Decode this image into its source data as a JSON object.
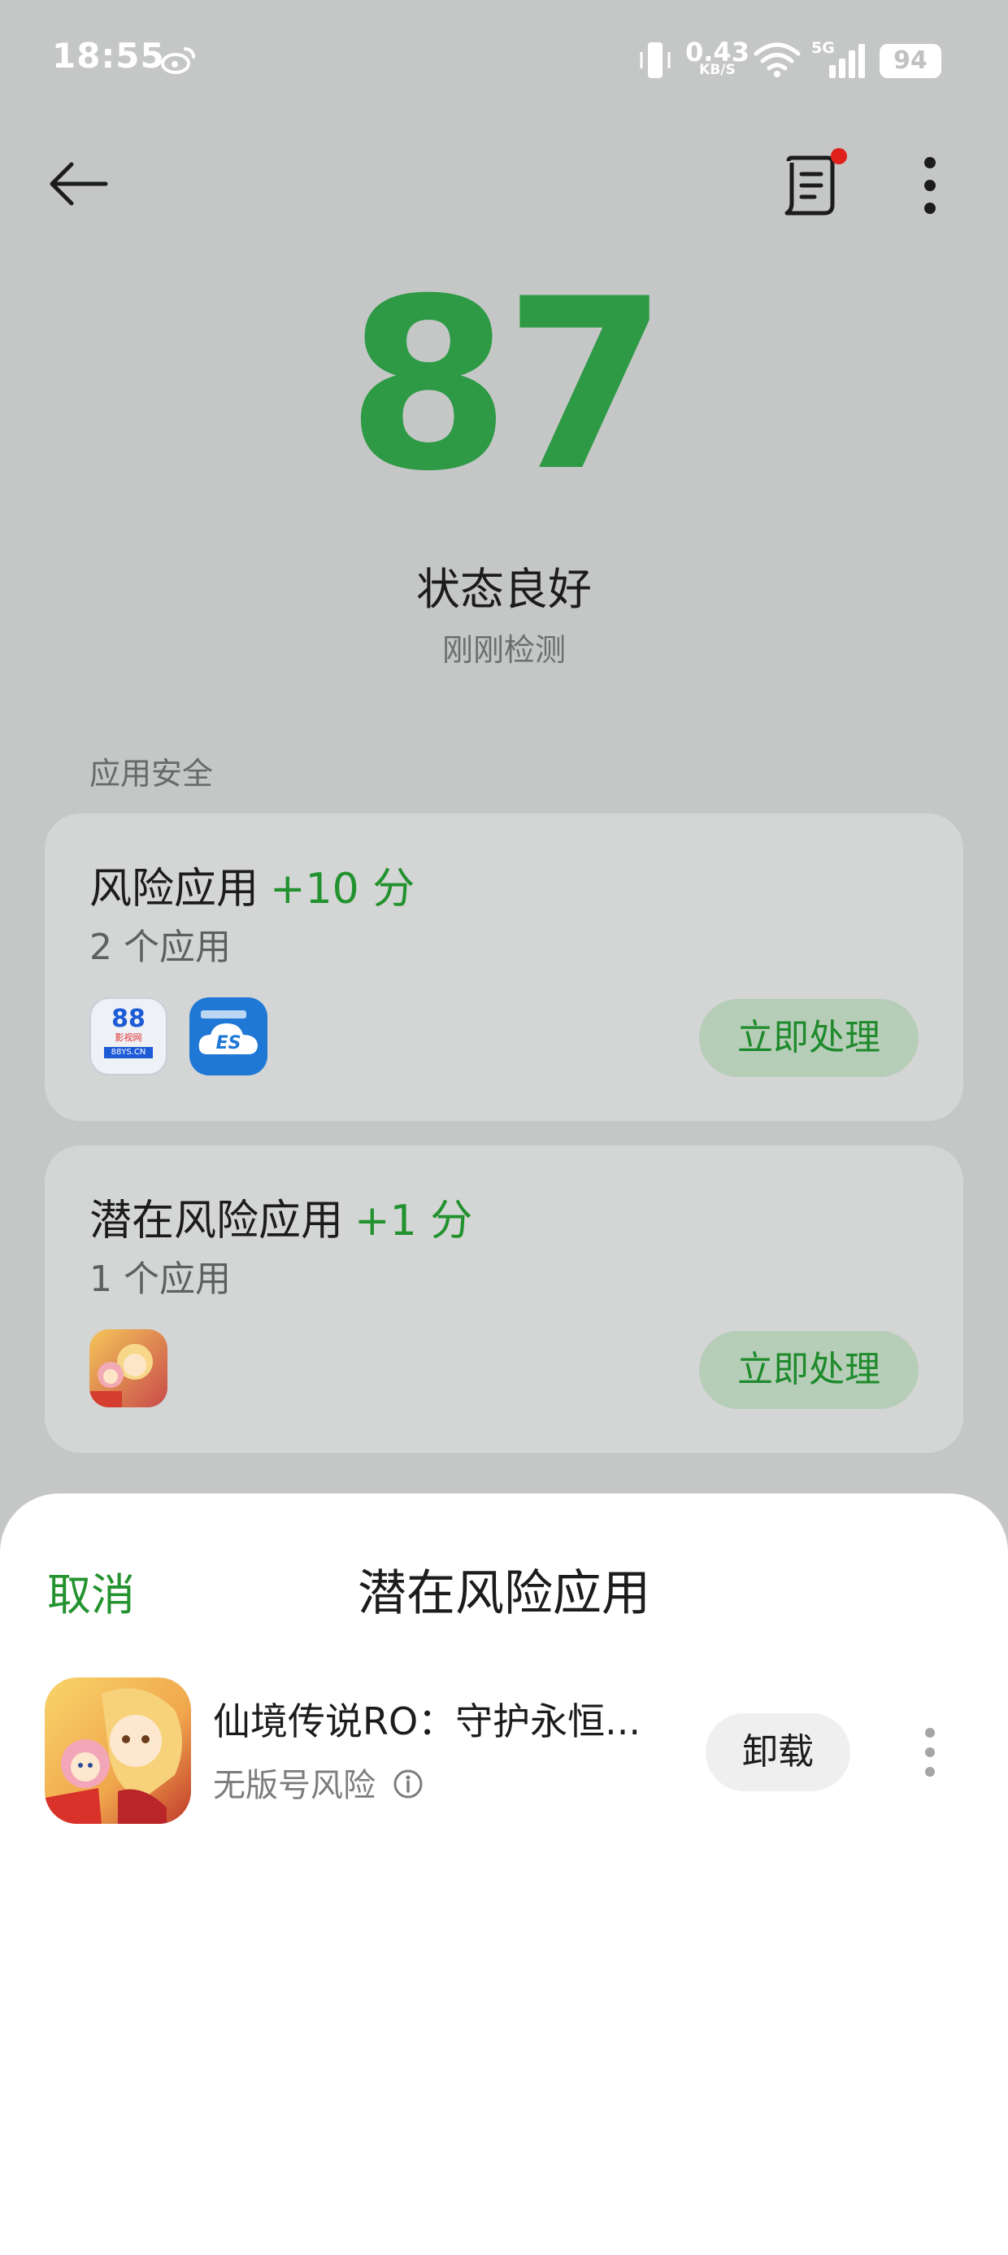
{
  "status_bar": {
    "time": "18:55",
    "net_speed": "0.43",
    "net_speed_unit": "KB/S",
    "network_type": "5G",
    "battery": "94",
    "icons": [
      "weibo-icon",
      "vibrate-icon",
      "wifi-icon",
      "signal-icon",
      "battery-icon"
    ]
  },
  "toolbar": {
    "back_icon": "back-arrow-icon",
    "report_icon": "report-icon",
    "more_icon": "more-vertical-icon"
  },
  "summary": {
    "score": "87",
    "status": "状态良好",
    "checked": "刚刚检测"
  },
  "section": {
    "label": "应用安全"
  },
  "cards": [
    {
      "title": "风险应用",
      "points": "+10 分",
      "count": "2 个应用",
      "button": "立即处理",
      "apps": [
        "app-88-icon",
        "es-file-icon"
      ]
    },
    {
      "title": "潜在风险应用",
      "points": "+1 分",
      "count": "1 个应用",
      "button": "立即处理",
      "apps": [
        "game-ro-icon"
      ]
    }
  ],
  "app_icons": {
    "app88_num": "88",
    "app88_sub": "影视网",
    "app88_domain": "88YS.CN",
    "es_mark": "ES"
  },
  "sheet": {
    "cancel": "取消",
    "title": "潜在风险应用",
    "item": {
      "name": "仙境传说RO：守护永恒...",
      "risk": "无版号风险",
      "uninstall": "卸载"
    }
  },
  "colors": {
    "accent_green": "#2e9a45",
    "button_bg": "#b6cdb7",
    "dim_bg": "#c5c7c6"
  }
}
